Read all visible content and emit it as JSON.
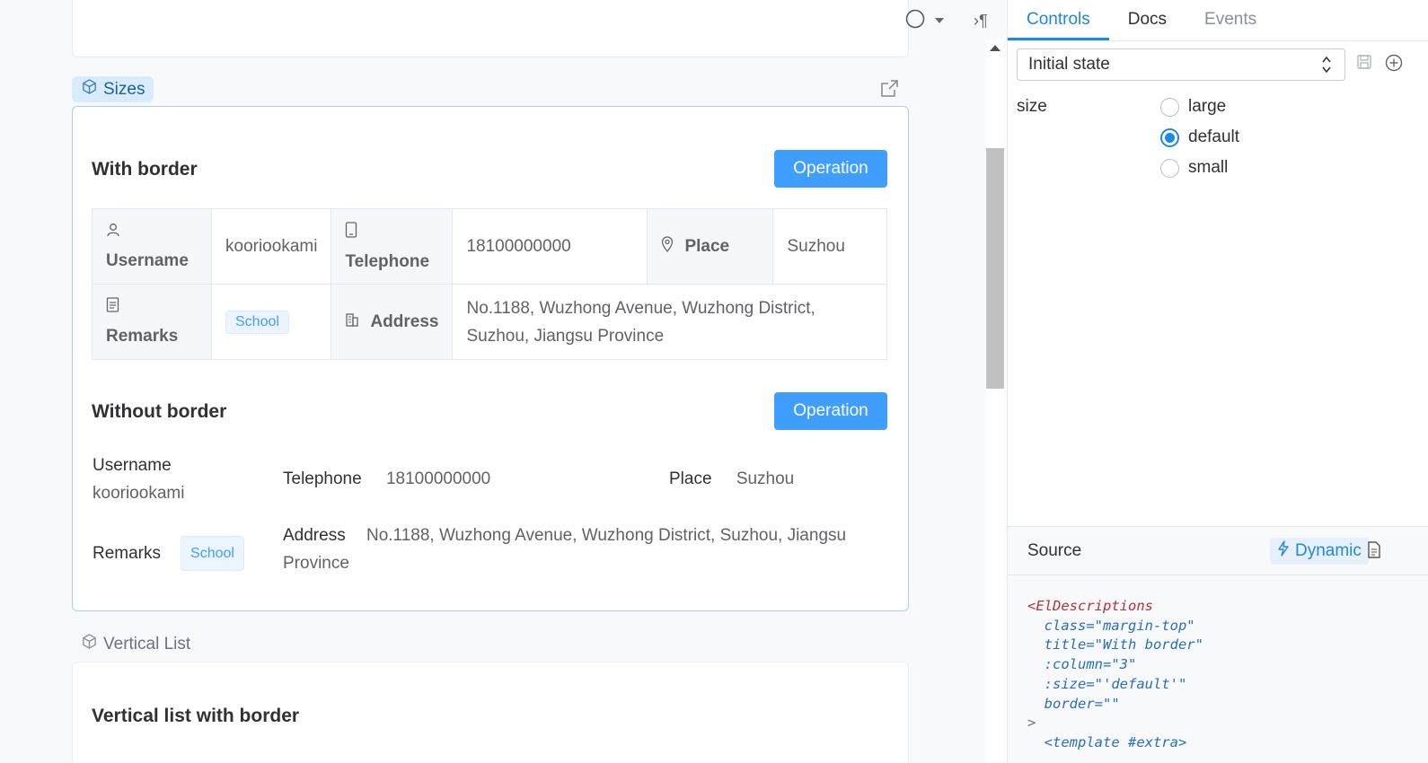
{
  "preview": {
    "stories": {
      "active": "Sizes",
      "next": "Vertical List"
    },
    "bordered_section": {
      "title": "With border",
      "operation": "Operation",
      "items": {
        "username_label": "Username",
        "username_value": "kooriookami",
        "telephone_label": "Telephone",
        "telephone_value": "18100000000",
        "place_label": "Place",
        "place_value": "Suzhou",
        "remarks_label": "Remarks",
        "remarks_tag": "School",
        "address_label": "Address",
        "address_value": "No.1188, Wuzhong Avenue, Wuzhong District, Suzhou, Jiangsu Province"
      }
    },
    "plain_section": {
      "title": "Without border",
      "operation": "Operation",
      "items": {
        "username_label": "Username",
        "username_value": "kooriookami",
        "telephone_label": "Telephone",
        "telephone_value": "18100000000",
        "place_label": "Place",
        "place_value": "Suzhou",
        "remarks_label": "Remarks",
        "remarks_tag": "School",
        "address_label": "Address",
        "address_line1": "No.1188, Wuzhong Avenue, Wuzhong District, Suzhou, Jiangsu",
        "address_line2": "Province"
      }
    },
    "vertical_section": {
      "title": "Vertical list with border"
    }
  },
  "addons": {
    "tabs": [
      "Controls",
      "Docs",
      "Events"
    ],
    "state_select": "Initial state",
    "control": {
      "name": "size",
      "options": [
        "large",
        "default",
        "small"
      ],
      "selected": "default"
    },
    "source": {
      "title": "Source",
      "mode": "Dynamic",
      "lines": [
        "<ElDescriptions",
        "  class=\"margin-top\"",
        "  title=\"With border\"",
        "  :column=\"3\"",
        "  :size=\"'default'\"",
        "  border=\"\"",
        ">",
        "  <template #extra>"
      ]
    }
  },
  "colors": {
    "accent": "#409eff",
    "panel_accent": "#1e88e5",
    "tag_bg": "#ecf5ff"
  }
}
